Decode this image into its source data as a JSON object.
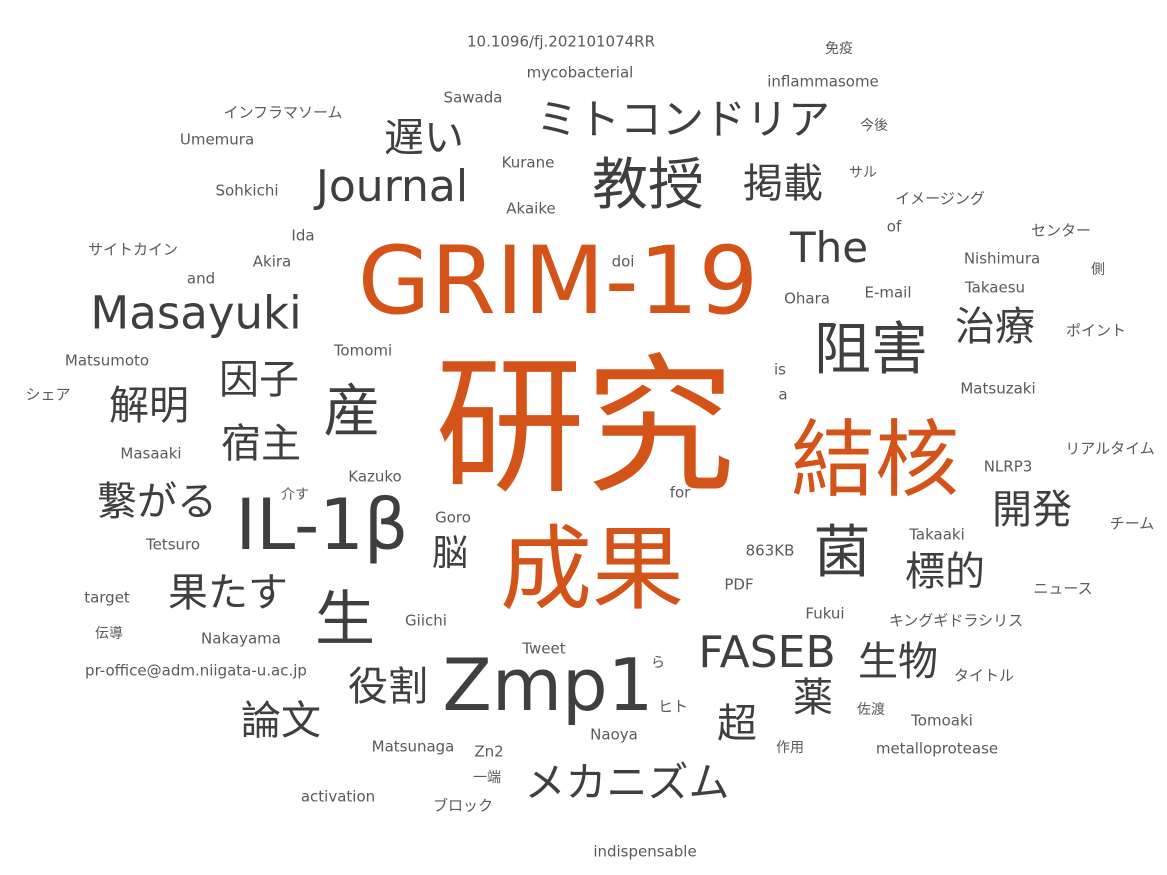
{
  "colors": {
    "accent": "#d35318",
    "dark": "#3f3f3f",
    "mid": "#5a5a5a",
    "light": "#6e6e6e"
  },
  "words": [
    {
      "text": "研究",
      "weight": 1.0,
      "tone": "accent"
    },
    {
      "text": "GRIM-19",
      "weight": 0.8,
      "tone": "accent"
    },
    {
      "text": "成果",
      "weight": 0.74,
      "tone": "accent"
    },
    {
      "text": "結核",
      "weight": 0.66,
      "tone": "accent"
    },
    {
      "text": "Zmp1",
      "weight": 0.58,
      "tone": "dark"
    },
    {
      "text": "IL-1β",
      "weight": 0.56,
      "tone": "dark"
    },
    {
      "text": "生",
      "weight": 0.5,
      "tone": "dark"
    },
    {
      "text": "菌",
      "weight": 0.48,
      "tone": "dark"
    },
    {
      "text": "産",
      "weight": 0.47,
      "tone": "dark"
    },
    {
      "text": "阻害",
      "weight": 0.46,
      "tone": "dark"
    },
    {
      "text": "教授",
      "weight": 0.46,
      "tone": "dark"
    },
    {
      "text": "Masayuki",
      "weight": 0.38,
      "tone": "dark"
    },
    {
      "text": "Journal",
      "weight": 0.37,
      "tone": "dark"
    },
    {
      "text": "FASEB",
      "weight": 0.37,
      "tone": "dark"
    },
    {
      "text": "ミトコンドリア",
      "weight": 0.36,
      "tone": "dark"
    },
    {
      "text": "The",
      "weight": 0.36,
      "tone": "dark"
    },
    {
      "text": "メカニズム",
      "weight": 0.35,
      "tone": "dark"
    },
    {
      "text": "果たす",
      "weight": 0.34,
      "tone": "dark"
    },
    {
      "text": "繋がる",
      "weight": 0.34,
      "tone": "dark"
    },
    {
      "text": "生物",
      "weight": 0.34,
      "tone": "dark"
    },
    {
      "text": "薬",
      "weight": 0.34,
      "tone": "dark"
    },
    {
      "text": "超",
      "weight": 0.34,
      "tone": "dark"
    },
    {
      "text": "遅い",
      "weight": 0.33,
      "tone": "dark"
    },
    {
      "text": "論文",
      "weight": 0.33,
      "tone": "dark"
    },
    {
      "text": "役割",
      "weight": 0.33,
      "tone": "dark"
    },
    {
      "text": "標的",
      "weight": 0.33,
      "tone": "dark"
    },
    {
      "text": "開発",
      "weight": 0.33,
      "tone": "dark"
    },
    {
      "text": "治療",
      "weight": 0.33,
      "tone": "dark"
    },
    {
      "text": "掲載",
      "weight": 0.33,
      "tone": "dark"
    },
    {
      "text": "解明",
      "weight": 0.33,
      "tone": "dark"
    },
    {
      "text": "因子",
      "weight": 0.33,
      "tone": "dark"
    },
    {
      "text": "宿主",
      "weight": 0.33,
      "tone": "dark"
    },
    {
      "text": "脳",
      "weight": 0.3,
      "tone": "dark"
    },
    {
      "text": "10.1096/fj.202101074RR",
      "weight": 0.13,
      "tone": "mid"
    },
    {
      "text": "mycobacterial",
      "weight": 0.13,
      "tone": "mid"
    },
    {
      "text": "免疫",
      "weight": 0.12,
      "tone": "mid"
    },
    {
      "text": "inflammasome",
      "weight": 0.13,
      "tone": "mid"
    },
    {
      "text": "Sawada",
      "weight": 0.13,
      "tone": "mid"
    },
    {
      "text": "インフラマソーム",
      "weight": 0.13,
      "tone": "mid"
    },
    {
      "text": "Umemura",
      "weight": 0.13,
      "tone": "mid"
    },
    {
      "text": "今後",
      "weight": 0.12,
      "tone": "mid"
    },
    {
      "text": "Kurane",
      "weight": 0.13,
      "tone": "mid"
    },
    {
      "text": "サル",
      "weight": 0.12,
      "tone": "mid"
    },
    {
      "text": "Sohkichi",
      "weight": 0.13,
      "tone": "mid"
    },
    {
      "text": "Akaike",
      "weight": 0.13,
      "tone": "mid"
    },
    {
      "text": "イメージング",
      "weight": 0.13,
      "tone": "mid"
    },
    {
      "text": "of",
      "weight": 0.13,
      "tone": "mid"
    },
    {
      "text": "Ida",
      "weight": 0.13,
      "tone": "mid"
    },
    {
      "text": "センター",
      "weight": 0.13,
      "tone": "mid"
    },
    {
      "text": "サイトカイン",
      "weight": 0.13,
      "tone": "mid"
    },
    {
      "text": "Akira",
      "weight": 0.13,
      "tone": "mid"
    },
    {
      "text": "doi",
      "weight": 0.13,
      "tone": "mid"
    },
    {
      "text": "Nishimura",
      "weight": 0.13,
      "tone": "mid"
    },
    {
      "text": "and",
      "weight": 0.13,
      "tone": "mid"
    },
    {
      "text": "側",
      "weight": 0.12,
      "tone": "mid"
    },
    {
      "text": "Ohara",
      "weight": 0.13,
      "tone": "mid"
    },
    {
      "text": "E-mail",
      "weight": 0.13,
      "tone": "mid"
    },
    {
      "text": "Takaesu",
      "weight": 0.13,
      "tone": "mid"
    },
    {
      "text": "ポイント",
      "weight": 0.13,
      "tone": "mid"
    },
    {
      "text": "Tomomi",
      "weight": 0.13,
      "tone": "mid"
    },
    {
      "text": "Matsumoto",
      "weight": 0.13,
      "tone": "mid"
    },
    {
      "text": "is",
      "weight": 0.13,
      "tone": "mid"
    },
    {
      "text": "a",
      "weight": 0.13,
      "tone": "mid"
    },
    {
      "text": "Matsuzaki",
      "weight": 0.13,
      "tone": "mid"
    },
    {
      "text": "シェア",
      "weight": 0.13,
      "tone": "mid"
    },
    {
      "text": "リアルタイム",
      "weight": 0.13,
      "tone": "mid"
    },
    {
      "text": "Masaaki",
      "weight": 0.13,
      "tone": "mid"
    },
    {
      "text": "NLRP3",
      "weight": 0.13,
      "tone": "mid"
    },
    {
      "text": "Kazuko",
      "weight": 0.13,
      "tone": "mid"
    },
    {
      "text": "介す",
      "weight": 0.12,
      "tone": "mid"
    },
    {
      "text": "for",
      "weight": 0.13,
      "tone": "mid"
    },
    {
      "text": "Goro",
      "weight": 0.13,
      "tone": "mid"
    },
    {
      "text": "チーム",
      "weight": 0.13,
      "tone": "mid"
    },
    {
      "text": "Takaaki",
      "weight": 0.13,
      "tone": "mid"
    },
    {
      "text": "Tetsuro",
      "weight": 0.13,
      "tone": "mid"
    },
    {
      "text": "863KB",
      "weight": 0.13,
      "tone": "mid"
    },
    {
      "text": "PDF",
      "weight": 0.13,
      "tone": "mid"
    },
    {
      "text": "ニュース",
      "weight": 0.13,
      "tone": "mid"
    },
    {
      "text": "target",
      "weight": 0.13,
      "tone": "mid"
    },
    {
      "text": "Fukui",
      "weight": 0.13,
      "tone": "mid"
    },
    {
      "text": "Giichi",
      "weight": 0.13,
      "tone": "mid"
    },
    {
      "text": "キングギドラシリス",
      "weight": 0.13,
      "tone": "mid"
    },
    {
      "text": "伝導",
      "weight": 0.12,
      "tone": "mid"
    },
    {
      "text": "Nakayama",
      "weight": 0.13,
      "tone": "mid"
    },
    {
      "text": "Tweet",
      "weight": 0.13,
      "tone": "mid"
    },
    {
      "text": "ら",
      "weight": 0.12,
      "tone": "mid"
    },
    {
      "text": "pr-office@adm.niigata-u.ac.jp",
      "weight": 0.13,
      "tone": "mid"
    },
    {
      "text": "タイトル",
      "weight": 0.13,
      "tone": "mid"
    },
    {
      "text": "ヒト",
      "weight": 0.13,
      "tone": "mid"
    },
    {
      "text": "佐渡",
      "weight": 0.12,
      "tone": "mid"
    },
    {
      "text": "Tomoaki",
      "weight": 0.13,
      "tone": "mid"
    },
    {
      "text": "Naoya",
      "weight": 0.13,
      "tone": "mid"
    },
    {
      "text": "Matsunaga",
      "weight": 0.13,
      "tone": "mid"
    },
    {
      "text": "Zn2",
      "weight": 0.13,
      "tone": "mid"
    },
    {
      "text": "作用",
      "weight": 0.12,
      "tone": "mid"
    },
    {
      "text": "metalloprotease",
      "weight": 0.13,
      "tone": "mid"
    },
    {
      "text": "一端",
      "weight": 0.12,
      "tone": "mid"
    },
    {
      "text": "activation",
      "weight": 0.13,
      "tone": "mid"
    },
    {
      "text": "ブロック",
      "weight": 0.13,
      "tone": "mid"
    },
    {
      "text": "indispensable",
      "weight": 0.13,
      "tone": "mid"
    }
  ]
}
